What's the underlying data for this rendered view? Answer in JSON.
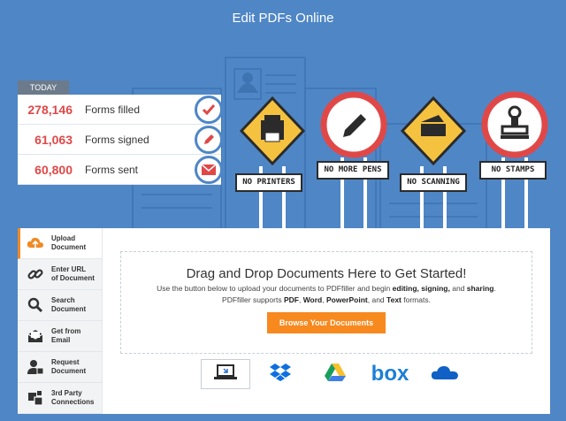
{
  "page": {
    "title": "Edit PDFs Online"
  },
  "stats": {
    "badge": "TODAY",
    "rows": [
      {
        "value": "278,146",
        "label": "Forms filled",
        "icon": "check-icon",
        "color": "#e04848"
      },
      {
        "value": "61,063",
        "label": "Forms signed",
        "icon": "pen-icon",
        "color": "#e04848"
      },
      {
        "value": "60,800",
        "label": "Forms sent",
        "icon": "envelope-icon",
        "color": "#e04848"
      }
    ]
  },
  "signs": [
    {
      "label": "NO PRINTERS",
      "icon": "printer-icon"
    },
    {
      "label": "NO MORE PENS",
      "icon": "pen-icon"
    },
    {
      "label": "NO SCANNING",
      "icon": "scanner-icon"
    },
    {
      "label": "NO STAMPS",
      "icon": "stamp-icon"
    }
  ],
  "tabs": [
    {
      "label": "Upload\nDocument",
      "icon": "cloud-upload-icon",
      "active": true
    },
    {
      "label": "Enter URL\nof Document",
      "icon": "link-icon"
    },
    {
      "label": "Search\nDocument",
      "icon": "search-icon"
    },
    {
      "label": "Get from\nEmail",
      "icon": "email-icon"
    },
    {
      "label": "Request\nDocument",
      "icon": "request-user-icon"
    },
    {
      "label": "3rd Party\nConnections",
      "icon": "connections-icon"
    }
  ],
  "dropzone": {
    "title": "Drag and Drop Documents Here to Get Started!",
    "line1_pre": "Use the button below to upload your documents to PDFfiller and begin ",
    "line1_b1": "editing,",
    "line1_mid1": " ",
    "line1_b2": "signing,",
    "line1_mid2": " and ",
    "line1_b3": "sharing",
    "line1_post": ".",
    "line2_pre": "PDFfiller supports ",
    "line2_b1": "PDF",
    "line2_sep1": ", ",
    "line2_b2": "Word",
    "line2_sep2": ", ",
    "line2_b3": "PowerPoint",
    "line2_sep3": ", and ",
    "line2_b4": "Text",
    "line2_post": " formats.",
    "button": "Browse Your Documents"
  },
  "sources": [
    {
      "name": "my-computer",
      "icon": "laptop-icon"
    },
    {
      "name": "dropbox",
      "icon": "dropbox-icon"
    },
    {
      "name": "google-drive",
      "icon": "google-drive-icon"
    },
    {
      "name": "box",
      "icon": "box-icon",
      "text": "box"
    },
    {
      "name": "onedrive",
      "icon": "onedrive-icon"
    }
  ],
  "colors": {
    "background": "#4f86c6",
    "accent": "#f7891f",
    "stat": "#e04848",
    "sign": "#f5c240",
    "circle_sign": "#e04848"
  }
}
